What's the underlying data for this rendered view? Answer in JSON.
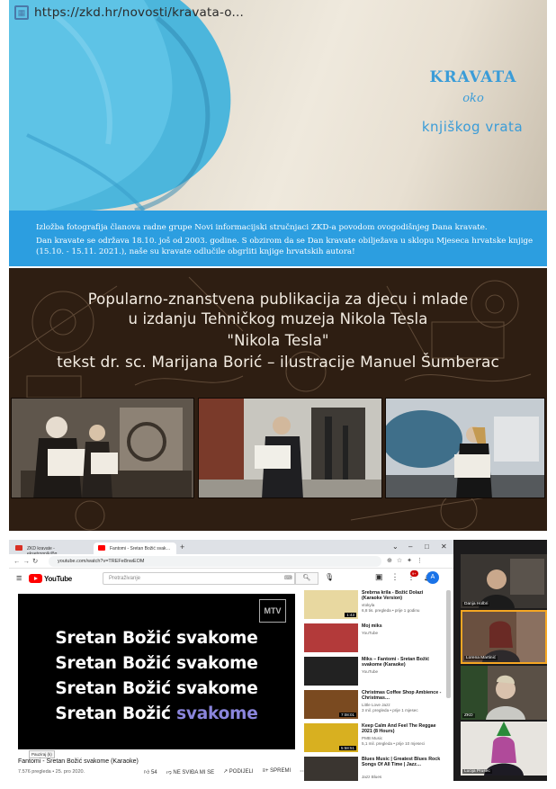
{
  "panel1": {
    "url": "https://zkd.hr/novosti/kravata-o...",
    "title_kravata": "KRAVATA",
    "title_oko": "oko",
    "title_vrata": "knjiškog vrata",
    "caption_line1": "Izložba fotografija članova radne grupe Novi informacijski stručnjaci ZKD-a povodom ovogodišnjeg Dana kravate.",
    "caption_line2": "Dan kravate se održava 18.10. još od 2003. godine.  S obzirom da se Dan kravate obilježava u sklopu Mjeseca hrvatske knjige (15.10. - 15.11. 2021.), naše su kravate odlučile obgrliti knjige hrvatskih autora!"
  },
  "panel2": {
    "line1": "Popularno-znanstvena publikacija za djecu i mlade",
    "line2": "u izdanju Tehničkog muzeja Nikola Tesla",
    "line3": "\"Nikola Tesla\"",
    "line4": "tekst dr. sc. Marijana Borić – ilustracije Manuel Šumberac"
  },
  "panel3": {
    "tabs": [
      {
        "label": "ZKD kravate - eksetropnik@g…",
        "color": "#d93025"
      },
      {
        "label": "Fantomi - Sretan Božić svak…",
        "color": "#ff0000"
      }
    ],
    "url": "youtube.com/watch?v=TREFe8nwEOM",
    "search_placeholder": "Pretraživanje",
    "notif_count": "9+",
    "avatar_letter": "A",
    "lyrics": [
      "Sretan Božić svakome",
      "Sretan Božić svakome",
      "Sretan Božić svakome"
    ],
    "lyric4_start": "Sretan Božić ",
    "lyric4_highlight": "svakome",
    "mtv_label": "MTV",
    "tooltip": "Pauziraj (k)",
    "video_title": "Fantomi - Sretan Božić svakome (Karaoke)",
    "video_meta": "7.576 pregleda • 25. pro 2020.",
    "actions": {
      "like": "54",
      "dislike": "NE SVIĐA MI SE",
      "share": "PODIJELI",
      "save": "SPREMI"
    },
    "recommendations": [
      {
        "title": "Srebrna krila - Božić Dolazi (Karaoke Version)",
        "channel": "vtokyla",
        "meta": "6,8 tis. pregleda • prije 1 godinu",
        "duration": "1:43",
        "thumb_color": "#e8d8a0"
      },
      {
        "title": "Moj miks",
        "channel": "YouTube",
        "meta": "",
        "duration": "",
        "thumb_color": "#b33a3a"
      },
      {
        "title": "Miks – Fantomi - Sretan Božić svakome (Karaoke)",
        "channel": "YouTube",
        "meta": "",
        "duration": "",
        "thumb_color": "#222222"
      },
      {
        "title": "Christmas Coffee Shop Ambience - Christmas…",
        "channel": "Little Love Jazz",
        "meta": "3 mil. pregleda • prije 1 mjesec",
        "duration": "7:08:01",
        "thumb_color": "#7a4a20"
      },
      {
        "title": "Keep Calm And Feel The Reggae 2021 (8 Hours)",
        "channel": "PMB Music",
        "meta": "5,1 mil. pregleda • prije 10 mjeseci",
        "duration": "5:58:51",
        "thumb_color": "#d8b020"
      },
      {
        "title": "Blues Music | Greatest Blues Rock Songs Of All Time | Jazz…",
        "channel": "Jazz Blues",
        "meta": "",
        "duration": "",
        "thumb_color": "#3a3530"
      }
    ],
    "participants": [
      {
        "name": "Danja Holbri"
      },
      {
        "name": "Lorena Martinić"
      },
      {
        "name": "ZKD"
      },
      {
        "name": "Lucija Prusec"
      }
    ]
  }
}
